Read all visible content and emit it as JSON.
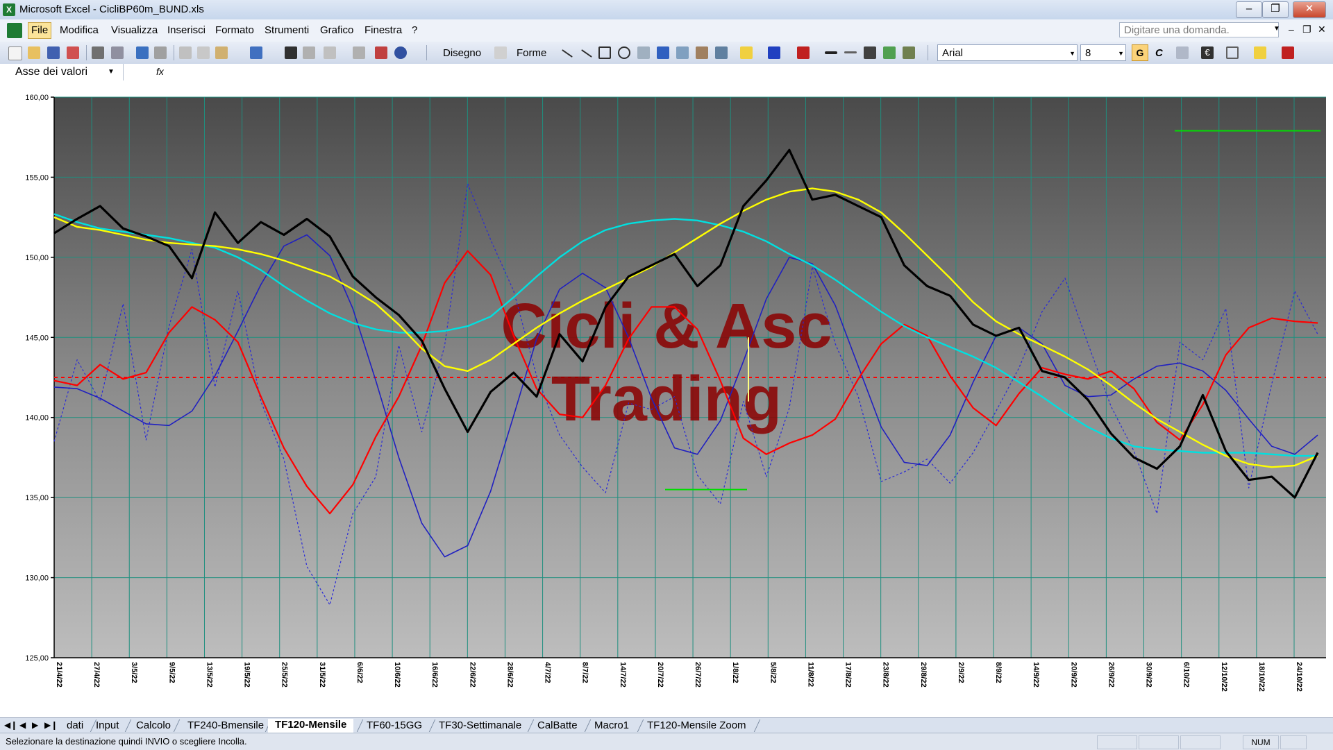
{
  "window": {
    "title": "Microsoft Excel - CicliBP60m_BUND.xls"
  },
  "menu": {
    "items": [
      "File",
      "Modifica",
      "Visualizza",
      "Inserisci",
      "Formato",
      "Strumenti",
      "Grafico",
      "Finestra",
      "?"
    ],
    "help_placeholder": "Digitare una domanda."
  },
  "toolbar": {
    "drawing_label": "Disegno",
    "shapes_label": "Forme",
    "font_name": "Arial",
    "font_size": "8",
    "bold_label": "G",
    "italic_label": "C"
  },
  "formula_bar": {
    "name_box": "Asse dei valori",
    "fx": "fx"
  },
  "chart_data": {
    "type": "line",
    "ylim": [
      125,
      160
    ],
    "y_ticks": [
      "160,00",
      "155,00",
      "150,00",
      "145,00",
      "140,00",
      "135,00",
      "130,00",
      "125,00"
    ],
    "x_ticks": [
      "21/4/22",
      "27/4/22",
      "3/5/22",
      "9/5/22",
      "13/5/22",
      "19/5/22",
      "25/5/22",
      "31/5/22",
      "6/6/22",
      "10/6/22",
      "16/6/22",
      "22/6/22",
      "28/6/22",
      "4/7/22",
      "8/7/22",
      "14/7/22",
      "20/7/22",
      "26/7/22",
      "1/8/22",
      "5/8/22",
      "11/8/22",
      "17/8/22",
      "23/8/22",
      "29/8/22",
      "2/9/22",
      "8/9/22",
      "14/9/22",
      "20/9/22",
      "26/9/22",
      "30/9/22",
      "6/10/22",
      "12/10/22",
      "18/10/22",
      "24/10/22"
    ],
    "watermark": [
      "Cicli & Asc",
      "Trading"
    ],
    "reference_level": 142.5,
    "colors": {
      "price": "#000000",
      "yellow_ma": "#ffff00",
      "cyan_ma": "#00e0e0",
      "red_osc": "#ff0000",
      "blue_cycle": "#2020c0",
      "blue_dotted": "#2a2ad8",
      "reference": "#ff0000",
      "green_marks": "#00dd00"
    },
    "series": [
      {
        "values": [
          151.5,
          152.4,
          153.2,
          151.8,
          151.3,
          150.7,
          148.7,
          152.8,
          150.9,
          152.2,
          151.4,
          152.4,
          151.3,
          148.8,
          147.5,
          146.4,
          144.8,
          141.8,
          139.1,
          141.6,
          142.8,
          141.3,
          145.2,
          143.5,
          146.9,
          148.8,
          149.5,
          150.2,
          148.2,
          149.5,
          153.2,
          154.8,
          156.7,
          153.6,
          153.9,
          153.2,
          152.5,
          149.5,
          148.2,
          147.6,
          145.8,
          145.1,
          145.6,
          142.9,
          142.5,
          141.1,
          139.0,
          137.5,
          136.8,
          138.2,
          141.4,
          137.9,
          136.1,
          136.3,
          135.0,
          137.8
        ]
      },
      {
        "values": [
          152.5,
          151.9,
          151.7,
          151.4,
          151.1,
          150.9,
          150.8,
          150.7,
          150.5,
          150.2,
          149.8,
          149.3,
          148.8,
          148.0,
          147.1,
          145.8,
          144.3,
          143.2,
          142.9,
          143.6,
          144.6,
          145.6,
          146.5,
          147.3,
          148.0,
          148.7,
          149.4,
          150.3,
          151.2,
          152.1,
          152.9,
          153.6,
          154.1,
          154.3,
          154.1,
          153.6,
          152.8,
          151.5,
          150.1,
          148.7,
          147.2,
          146.0,
          145.2,
          144.5,
          143.8,
          143.0,
          142.0,
          140.9,
          139.9,
          139.1,
          138.3,
          137.6,
          137.1,
          136.9,
          137.0,
          137.6
        ]
      },
      {
        "values": [
          152.7,
          152.2,
          151.8,
          151.6,
          151.4,
          151.2,
          150.9,
          150.6,
          150.0,
          149.2,
          148.2,
          147.3,
          146.5,
          145.9,
          145.5,
          145.3,
          145.3,
          145.4,
          145.7,
          146.3,
          147.5,
          148.8,
          150.0,
          151.0,
          151.7,
          152.1,
          152.3,
          152.4,
          152.3,
          152.0,
          151.6,
          151.0,
          150.2,
          149.5,
          148.6,
          147.6,
          146.6,
          145.7,
          145.0,
          144.4,
          143.8,
          143.1,
          142.2,
          141.3,
          140.3,
          139.4,
          138.7,
          138.2,
          138.0,
          137.9,
          137.8,
          137.8,
          137.8,
          137.7,
          137.6,
          137.6
        ]
      },
      {
        "values": [
          142.3,
          142.0,
          143.3,
          142.4,
          142.8,
          145.3,
          146.9,
          146.1,
          144.7,
          141.3,
          138.1,
          135.7,
          134.0,
          135.8,
          138.8,
          141.3,
          144.5,
          148.4,
          150.4,
          148.9,
          145.1,
          141.8,
          140.2,
          140.0,
          142.0,
          144.9,
          146.9,
          146.9,
          145.5,
          142.3,
          138.7,
          137.7,
          138.4,
          138.9,
          139.9,
          142.4,
          144.6,
          145.8,
          145.1,
          142.6,
          140.6,
          139.5,
          141.5,
          143.1,
          142.7,
          142.4,
          142.9,
          141.8,
          139.7,
          138.6,
          140.8,
          143.9,
          145.6,
          146.2,
          146.0,
          145.9
        ]
      },
      {
        "values": [
          141.9,
          141.8,
          141.2,
          140.4,
          139.6,
          139.5,
          140.4,
          142.6,
          145.4,
          148.3,
          150.7,
          151.4,
          150.1,
          146.8,
          142.3,
          137.5,
          133.4,
          131.3,
          132.0,
          135.4,
          140.1,
          144.9,
          148.0,
          149.0,
          148.1,
          145.0,
          141.2,
          138.1,
          137.7,
          139.8,
          143.5,
          147.4,
          150.0,
          149.6,
          147.0,
          143.2,
          139.4,
          137.2,
          137.0,
          138.9,
          142.2,
          145.1,
          145.6,
          144.6,
          142.0,
          141.3,
          141.4,
          142.4,
          143.2,
          143.4,
          142.9,
          141.7,
          139.9,
          138.2,
          137.7,
          138.9
        ]
      },
      {
        "values": [
          138.5,
          143.6,
          141.0,
          147.1,
          138.6,
          145.7,
          150.5,
          141.9,
          147.9,
          141.0,
          137.4,
          130.7,
          128.3,
          134.0,
          136.3,
          144.5,
          139.1,
          144.5,
          154.6,
          151.1,
          147.9,
          142.6,
          138.9,
          136.9,
          135.3,
          140.9,
          140.5,
          141.3,
          136.4,
          134.6,
          141.0,
          136.3,
          140.6,
          149.4,
          144.6,
          141.3,
          136.0,
          136.6,
          137.4,
          135.9,
          137.8,
          140.4,
          143.1,
          146.6,
          148.7,
          144.6,
          140.7,
          137.9,
          134.0,
          144.7,
          143.6,
          146.8,
          135.6,
          142.1,
          147.9,
          145.2
        ]
      }
    ],
    "green_marks_levels": [
      157.9,
      135.5
    ]
  },
  "sheet_tabs": {
    "tabs": [
      "dati",
      "Input",
      "Calcolo",
      "TF240-Bmensile",
      "TF120-Mensile",
      "TF60-15GG",
      "TF30-Settimanale",
      "CalBatte",
      "Macro1",
      "TF120-Mensile Zoom"
    ],
    "active": "TF120-Mensile"
  },
  "status": {
    "message": "Selezionare la destinazione quindi INVIO o scegliere Incolla.",
    "num": "NUM"
  }
}
